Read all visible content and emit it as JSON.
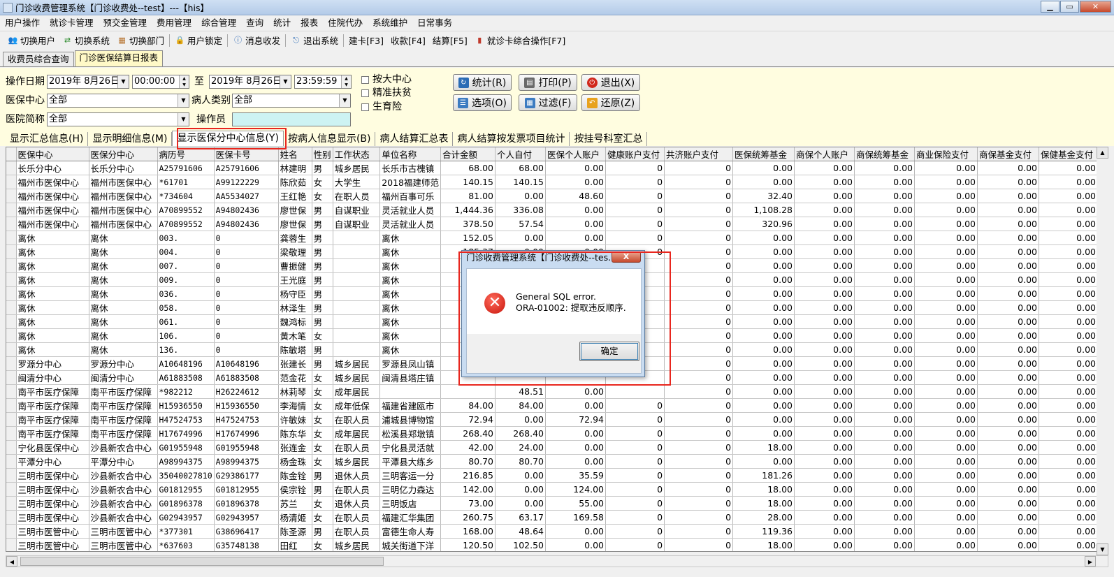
{
  "window": {
    "title": "门诊收费管理系统【门诊收费处--test】---【his】"
  },
  "menu": [
    "用户操作",
    "就诊卡管理",
    "预交金管理",
    "费用管理",
    "综合管理",
    "查询",
    "统计",
    "报表",
    "住院代办",
    "系统维护",
    "日常事务"
  ],
  "toolbar": [
    "切换用户",
    "切换系统",
    "切换部门",
    "用户锁定",
    "消息收发",
    "退出系统",
    "建卡[F3]",
    "收款[F4]",
    "结算[F5]",
    "就诊卡综合操作[F7]"
  ],
  "top_tabs": [
    "收费员综合查询",
    "门诊医保结算日报表"
  ],
  "filters": {
    "op_date_label": "操作日期",
    "date_from": "2019年  8月26日",
    "time_from": "00:00:00",
    "to_label": "至",
    "date_to": "2019年  8月26日",
    "time_to": "23:59:59",
    "center_label": "医保中心",
    "center_value": "全部",
    "patient_type_label": "病人类别",
    "patient_type_value": "全部",
    "hospital_label": "医院简称",
    "hospital_value": "全部",
    "operator_label": "操作员",
    "operator_value": "",
    "chk_center": "按大中心",
    "chk_poverty": "精准扶贫",
    "chk_maternity": "生育险"
  },
  "buttons": {
    "stat": "统计(R)",
    "print": "打印(P)",
    "exit": "退出(X)",
    "options": "选项(O)",
    "filter": "过滤(F)",
    "restore": "还原(Z)"
  },
  "sub_tabs": [
    "显示汇总信息(H)",
    "显示明细信息(M)",
    "显示医保分中心信息(Y)",
    "按病人信息显示(B)",
    "病人结算汇总表",
    "病人结算按发票项目统计",
    "按挂号科室汇总"
  ],
  "grid": {
    "columns": [
      "医保中心",
      "医保分中心",
      "病历号",
      "医保卡号",
      "姓名",
      "性别",
      "工作状态",
      "单位名称",
      "合计金额",
      "个人自付",
      "医保个人账户",
      "健康账户支付",
      "共济账户支付",
      "医保统筹基金",
      "商保个人账户",
      "商保统筹基金",
      "商业保险支付",
      "商保基金支付",
      "保健基金支付"
    ],
    "rows": [
      [
        "长乐分中心",
        "长乐分中心",
        "A25791606",
        "A25791606",
        "林建明",
        "男",
        "城乡居民",
        "长乐市古槐镇",
        "68.00",
        "68.00",
        "0.00",
        "0",
        "0",
        "0.00",
        "0.00",
        "0.00",
        "0.00",
        "0.00",
        "0.00"
      ],
      [
        "福州市医保中心",
        "福州市医保中心",
        "*61701",
        "A99122229",
        "陈欣茹",
        "女",
        "大学生",
        "2018福建师范",
        "140.15",
        "140.15",
        "0.00",
        "0",
        "0",
        "0.00",
        "0.00",
        "0.00",
        "0.00",
        "0.00",
        "0.00"
      ],
      [
        "福州市医保中心",
        "福州市医保中心",
        "*734604",
        "AA5534027",
        "王红艳",
        "女",
        "在职人员",
        "福州百事可乐",
        "81.00",
        "0.00",
        "48.60",
        "0",
        "0",
        "32.40",
        "0.00",
        "0.00",
        "0.00",
        "0.00",
        "0.00"
      ],
      [
        "福州市医保中心",
        "福州市医保中心",
        "A70899552",
        "A94802436",
        "廖世保",
        "男",
        "自谋职业",
        "灵活就业人员",
        "1,444.36",
        "336.08",
        "0.00",
        "0",
        "0",
        "1,108.28",
        "0.00",
        "0.00",
        "0.00",
        "0.00",
        "0.00"
      ],
      [
        "福州市医保中心",
        "福州市医保中心",
        "A70899552",
        "A94802436",
        "廖世保",
        "男",
        "自谋职业",
        "灵活就业人员",
        "378.50",
        "57.54",
        "0.00",
        "0",
        "0",
        "320.96",
        "0.00",
        "0.00",
        "0.00",
        "0.00",
        "0.00"
      ],
      [
        "离休",
        "离休",
        "003.",
        "0",
        "龚蓉生",
        "男",
        "",
        "离休",
        "152.05",
        "0.00",
        "0.00",
        "0",
        "0",
        "0.00",
        "0.00",
        "0.00",
        "0.00",
        "0.00",
        "0.00"
      ],
      [
        "离休",
        "离休",
        "004.",
        "0",
        "梁敬理",
        "男",
        "",
        "离休",
        "185.37",
        "0.00",
        "0.00",
        "0",
        "0",
        "0.00",
        "0.00",
        "0.00",
        "0.00",
        "0.00",
        "0.00"
      ],
      [
        "离休",
        "离休",
        "007.",
        "0",
        "曹振健",
        "男",
        "",
        "离休",
        "2",
        "",
        "",
        "",
        "0",
        "0.00",
        "0.00",
        "0.00",
        "0.00",
        "0.00",
        "0.00"
      ],
      [
        "离休",
        "离休",
        "009.",
        "0",
        "王光庭",
        "男",
        "",
        "离休",
        "2",
        "",
        "",
        "",
        "0",
        "0.00",
        "0.00",
        "0.00",
        "0.00",
        "0.00",
        "0.00"
      ],
      [
        "离休",
        "离休",
        "036.",
        "0",
        "杨守臣",
        "男",
        "",
        "离休",
        "",
        "",
        "",
        "",
        "0",
        "0.00",
        "0.00",
        "0.00",
        "0.00",
        "0.00",
        "0.00"
      ],
      [
        "离休",
        "离休",
        "058.",
        "0",
        "林泽生",
        "男",
        "",
        "离休",
        "",
        "",
        "",
        "",
        "0",
        "0.00",
        "0.00",
        "0.00",
        "0.00",
        "0.00",
        "0.00"
      ],
      [
        "离休",
        "离休",
        "061.",
        "0",
        "魏鸿标",
        "男",
        "",
        "离休",
        "2",
        "",
        "",
        "",
        "0",
        "0.00",
        "0.00",
        "0.00",
        "0.00",
        "0.00",
        "0.00"
      ],
      [
        "离休",
        "离休",
        "106.",
        "0",
        "黄木笔",
        "女",
        "",
        "离休",
        "1",
        "",
        "",
        "",
        "0",
        "0.00",
        "0.00",
        "0.00",
        "0.00",
        "0.00",
        "0.00"
      ],
      [
        "离休",
        "离休",
        "136.",
        "0",
        "陈敏塔",
        "男",
        "",
        "离休",
        "2",
        "",
        "",
        "",
        "0",
        "0.00",
        "0.00",
        "0.00",
        "0.00",
        "0.00",
        "0.00"
      ],
      [
        "罗源分中心",
        "罗源分中心",
        "A10648196",
        "A10648196",
        "张建长",
        "男",
        "城乡居民",
        "罗源县凤山镇",
        "2",
        "",
        "",
        "",
        "0",
        "0.00",
        "0.00",
        "0.00",
        "0.00",
        "0.00",
        "0.00"
      ],
      [
        "闽清分中心",
        "闽清分中心",
        "A61883508",
        "A61883508",
        "范金花",
        "女",
        "城乡居民",
        "闽清县塔庄镇",
        "",
        "",
        "",
        "",
        "0",
        "0.00",
        "0.00",
        "0.00",
        "0.00",
        "0.00",
        "0.00"
      ],
      [
        "南平市医疗保障",
        "南平市医疗保障",
        "*982212",
        "H26224612",
        "林莉琴",
        "女",
        "成年居民",
        "",
        "",
        "48.51",
        "0.00",
        "",
        "0",
        "0.00",
        "0.00",
        "0.00",
        "0.00",
        "0.00",
        "0.00"
      ],
      [
        "南平市医疗保障",
        "南平市医疗保障",
        "H15936550",
        "H15936550",
        "李海情",
        "女",
        "成年低保",
        "福建省建瓯市",
        "84.00",
        "84.00",
        "0.00",
        "0",
        "0",
        "0.00",
        "0.00",
        "0.00",
        "0.00",
        "0.00",
        "0.00"
      ],
      [
        "南平市医疗保障",
        "南平市医疗保障",
        "H47524753",
        "H47524753",
        "许敏妹",
        "女",
        "在职人员",
        "浦城县博物馆",
        "72.94",
        "0.00",
        "72.94",
        "0",
        "0",
        "0.00",
        "0.00",
        "0.00",
        "0.00",
        "0.00",
        "0.00"
      ],
      [
        "南平市医疗保障",
        "南平市医疗保障",
        "H17674996",
        "H17674996",
        "陈东华",
        "女",
        "成年居民",
        "松溪县郑墩镇",
        "268.40",
        "268.40",
        "0.00",
        "0",
        "0",
        "0.00",
        "0.00",
        "0.00",
        "0.00",
        "0.00",
        "0.00"
      ],
      [
        "宁化县医保中心",
        "沙县新农合中心",
        "G01955948",
        "G01955948",
        "张连金",
        "女",
        "在职人员",
        "宁化县灵活就",
        "42.00",
        "24.00",
        "0.00",
        "0",
        "0",
        "18.00",
        "0.00",
        "0.00",
        "0.00",
        "0.00",
        "0.00"
      ],
      [
        "平潭分中心",
        "平潭分中心",
        "A98994375",
        "A98994375",
        "杨金珠",
        "女",
        "城乡居民",
        "平潭县大练乡",
        "80.70",
        "80.70",
        "0.00",
        "0",
        "0",
        "0.00",
        "0.00",
        "0.00",
        "0.00",
        "0.00",
        "0.00"
      ],
      [
        "三明市医保中心",
        "沙县新农合中心",
        "35040027810",
        "G29386177",
        "陈金铨",
        "男",
        "退休人员",
        "三明客运一分",
        "216.85",
        "0.00",
        "35.59",
        "0",
        "0",
        "181.26",
        "0.00",
        "0.00",
        "0.00",
        "0.00",
        "0.00"
      ],
      [
        "三明市医保中心",
        "沙县新农合中心",
        "G01812955",
        "G01812955",
        "侯宗铨",
        "男",
        "在职人员",
        "三明亿力森达",
        "142.00",
        "0.00",
        "124.00",
        "0",
        "0",
        "18.00",
        "0.00",
        "0.00",
        "0.00",
        "0.00",
        "0.00"
      ],
      [
        "三明市医保中心",
        "沙县新农合中心",
        "G01896378",
        "G01896378",
        "苏兰",
        "女",
        "退休人员",
        "三明饭店",
        "73.00",
        "0.00",
        "55.00",
        "0",
        "0",
        "18.00",
        "0.00",
        "0.00",
        "0.00",
        "0.00",
        "0.00"
      ],
      [
        "三明市医保中心",
        "沙县新农合中心",
        "G02943957",
        "G02943957",
        "杨清姬",
        "女",
        "在职人员",
        "福建汇华集团",
        "260.75",
        "63.17",
        "169.58",
        "0",
        "0",
        "28.00",
        "0.00",
        "0.00",
        "0.00",
        "0.00",
        "0.00"
      ],
      [
        "三明市医管中心",
        "三明市医管中心",
        "*377301",
        "G38696417",
        "陈圣源",
        "男",
        "在职人员",
        "富德生命人寿",
        "168.00",
        "48.64",
        "0.00",
        "0",
        "0",
        "119.36",
        "0.00",
        "0.00",
        "0.00",
        "0.00",
        "0.00"
      ],
      [
        "三明市医管中心",
        "三明市医管中心",
        "*637603",
        "G35748138",
        "田红",
        "女",
        "城乡居民",
        "城关街道下洋",
        "120.50",
        "102.50",
        "0.00",
        "0",
        "0",
        "18.00",
        "0.00",
        "0.00",
        "0.00",
        "0.00",
        "0.00"
      ],
      [
        "三明市医管中心",
        "三明市医管中心",
        "35980007460",
        "G44527062",
        "黄修麟",
        "男",
        "公务员（在",
        "三明市林业局",
        "35.00",
        "35.00",
        "0.00",
        "0",
        "0",
        "0.00",
        "0.00",
        "0.00",
        "0.00",
        "0.00",
        "0.00"
      ],
      [
        "三明市医管中心",
        "沙县新农合中心",
        "G00586503",
        "G00586503",
        "郑锦华",
        "男",
        "普通退休",
        "三明市公路局",
        "201.20",
        "0.00",
        "37.50",
        "0",
        "0",
        "163.70",
        "0.00",
        "0.00",
        "0.00",
        "0.00",
        "0.00"
      ]
    ]
  },
  "dialog": {
    "title": "门诊收费管理系统【门诊收费处--tes...",
    "message1": "General SQL error.",
    "message2": "ORA-01002: 提取违反顺序.",
    "ok": "确定",
    "close": "X"
  },
  "colors": {
    "highlight": "#e8261e",
    "filter_bg": "#fffde0",
    "active_tab": "#fff9c7",
    "error": "#c8160b"
  },
  "icons": {
    "close": "close-icon",
    "error": "error-icon"
  }
}
